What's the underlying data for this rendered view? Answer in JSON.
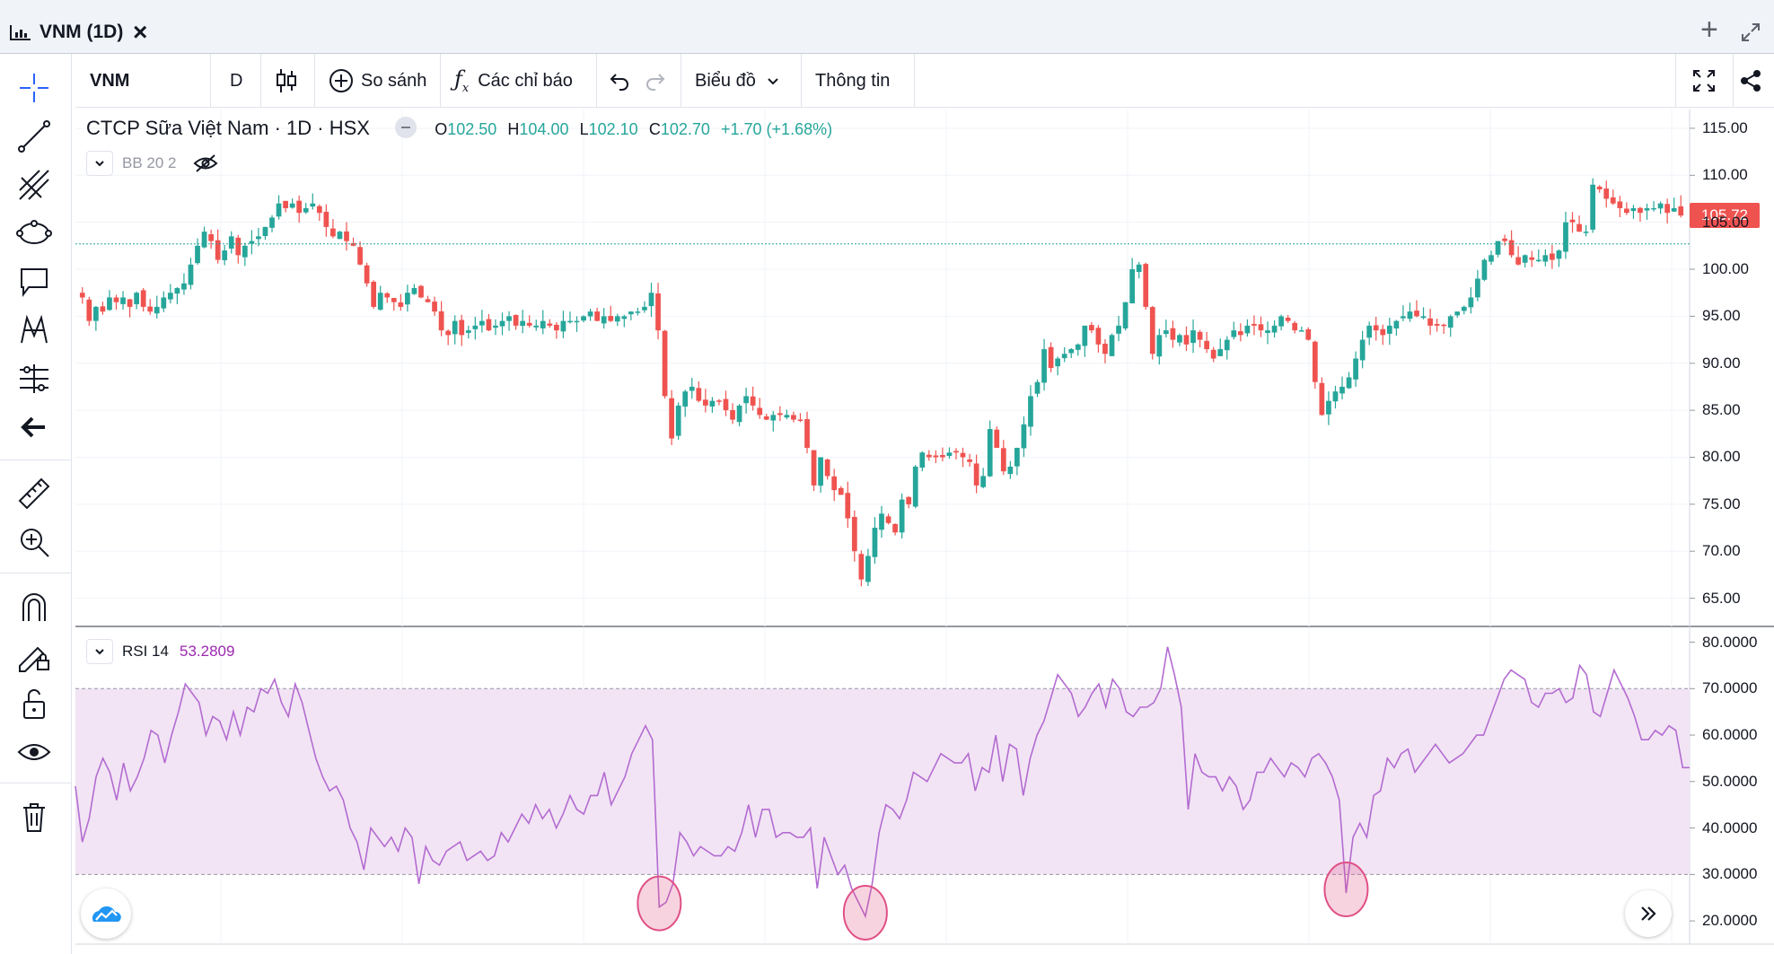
{
  "window": {
    "title": "VNM (1D)",
    "close_glyph": "×",
    "add_glyph": "+",
    "expand_icon": "expand-diagonal-icon"
  },
  "toolbar": {
    "symbol": "VNM",
    "interval": "D",
    "chart_style_icon": "candles-icon",
    "compare_label": "So sánh",
    "indicators_label": "Các chỉ báo",
    "chart_label": "Biểu đồ",
    "info_label": "Thông tin",
    "fullscreen_icon": "fullscreen-icon",
    "share_icon": "share-icon"
  },
  "left_toolbar": {
    "tools": [
      "crosshair-icon",
      "trend-line-icon",
      "fib-icon",
      "ellipse-icon",
      "callout-icon",
      "pattern-icon",
      "measure-line-icon",
      "back-arrow-icon",
      "ruler-icon",
      "zoom-in-icon",
      "magnet-icon",
      "lock-draw-icon",
      "lock-icon",
      "eye-icon",
      "trash-icon"
    ]
  },
  "legend": {
    "company": "CTCP Sữa Việt Nam",
    "interval": "1D",
    "exchange": "HSX",
    "dot": "·",
    "open_label": "O",
    "open": "102.50",
    "high_label": "H",
    "high": "104.00",
    "low_label": "L",
    "low": "102.10",
    "close_label": "C",
    "close": "102.70",
    "change": "+1.70 (+1.68%)"
  },
  "bb_legend": {
    "label": "BB 20 2"
  },
  "rsi_legend": {
    "label": "RSI 14",
    "value": "53.2809"
  },
  "price_badge": "105.72",
  "colors": {
    "up": "#26a69a",
    "down": "#ef5350",
    "rsi_line": "#b36bd1",
    "rsi_band": "#f2e4f4",
    "highlight_circle": "#e05085",
    "price_line": "#26a69a"
  },
  "chart_data": [
    {
      "type": "candlestick",
      "symbol": "VNM",
      "title": "CTCP Sữa Việt Nam",
      "ylim": [
        62,
        117
      ],
      "y_ticks": [
        "115.00",
        "110.00",
        "105.00",
        "100.00",
        "95.00",
        "90.00",
        "85.00",
        "80.00",
        "75.00",
        "70.00",
        "65.00"
      ],
      "last_price": 105.72,
      "closes": [
        97.0,
        94.5,
        96.0,
        95.5,
        97.0,
        96.5,
        97.0,
        96.0,
        97.5,
        96.0,
        95.5,
        96.0,
        97.0,
        97.5,
        98.0,
        98.5,
        100.5,
        102.5,
        104.0,
        103.0,
        101.0,
        102.0,
        103.5,
        101.5,
        102.5,
        103.0,
        103.5,
        104.5,
        105.5,
        107.0,
        106.5,
        107.0,
        106.0,
        106.5,
        107.0,
        106.0,
        104.5,
        103.5,
        104.0,
        103.0,
        102.5,
        100.5,
        98.5,
        96.0,
        97.5,
        97.0,
        96.5,
        96.0,
        97.5,
        98.0,
        97.0,
        96.5,
        95.5,
        93.5,
        93.0,
        94.5,
        93.0,
        93.5,
        94.0,
        94.5,
        93.5,
        94.0,
        94.5,
        95.0,
        94.0,
        94.5,
        94.0,
        94.0,
        94.5,
        94.0,
        93.5,
        94.5,
        94.5,
        94.5,
        95.0,
        95.5,
        94.5,
        95.0,
        94.5,
        95.0,
        95.0,
        95.5,
        95.5,
        96.0,
        97.5,
        93.5,
        86.5,
        82.0,
        85.5,
        87.0,
        87.5,
        86.0,
        85.5,
        86.0,
        86.0,
        85.0,
        84.0,
        85.5,
        86.5,
        85.5,
        84.5,
        84.0,
        84.5,
        84.5,
        84.5,
        84.0,
        84.0,
        81.0,
        77.0,
        80.0,
        78.0,
        76.5,
        76.0,
        73.5,
        70.0,
        67.0,
        69.5,
        72.5,
        74.0,
        73.0,
        72.0,
        75.5,
        75.0,
        79.0,
        80.5,
        80.0,
        80.0,
        80.0,
        80.5,
        80.5,
        80.0,
        79.5,
        77.0,
        78.0,
        83.0,
        81.0,
        78.5,
        79.0,
        81.0,
        83.5,
        86.5,
        88.0,
        91.5,
        89.5,
        90.5,
        91.0,
        91.5,
        92.0,
        94.0,
        93.5,
        92.0,
        91.0,
        93.0,
        94.0,
        96.5,
        100.0,
        100.5,
        96.0,
        91.0,
        93.0,
        93.5,
        92.5,
        93.0,
        92.0,
        93.5,
        92.5,
        91.5,
        90.5,
        91.5,
        92.5,
        93.5,
        93.0,
        94.0,
        94.0,
        93.5,
        93.5,
        94.0,
        95.0,
        94.5,
        93.5,
        93.5,
        92.5,
        88.0,
        84.5,
        86.0,
        87.0,
        87.5,
        88.5,
        90.5,
        92.5,
        94.0,
        93.5,
        93.0,
        94.0,
        94.5,
        95.0,
        95.5,
        95.0,
        95.0,
        94.0,
        94.0,
        94.0,
        95.0,
        95.5,
        96.0,
        97.0,
        99.0,
        101.0,
        101.5,
        103.0,
        103.0,
        101.5,
        100.5,
        101.5,
        101.0,
        101.0,
        101.5,
        101.0,
        102.0,
        105.0,
        105.0,
        104.0,
        104.0,
        109.0,
        108.5,
        107.5,
        107.0,
        106.5,
        106.0,
        106.5,
        106.0,
        106.5,
        106.5,
        107.0,
        106.0,
        106.5,
        105.72
      ]
    },
    {
      "type": "line",
      "name": "RSI 14",
      "ylim": [
        15,
        83
      ],
      "y_ticks": [
        "80.0000",
        "70.0000",
        "60.0000",
        "50.0000",
        "40.0000",
        "30.0000",
        "20.0000"
      ],
      "bands": [
        30,
        70
      ],
      "values": [
        49,
        37,
        42,
        51,
        55,
        52,
        46,
        54,
        48,
        51,
        55,
        61,
        60,
        54,
        60,
        65,
        71,
        69,
        67,
        60,
        64,
        63,
        59,
        65,
        60,
        66,
        65,
        70,
        69,
        72,
        67,
        64,
        71,
        67,
        61,
        55,
        51,
        48,
        49,
        46,
        40,
        37,
        31,
        40,
        38,
        36,
        38,
        35,
        40,
        38,
        28,
        36,
        33,
        32,
        35,
        36,
        37,
        33,
        34,
        35,
        33,
        34,
        39,
        37,
        40,
        43,
        41,
        45,
        42,
        44,
        40,
        43,
        47,
        44,
        43,
        47,
        47,
        52,
        45,
        48,
        51,
        56,
        59,
        62,
        59,
        23,
        24,
        28,
        39,
        37,
        34,
        36,
        35,
        34,
        34,
        36,
        35,
        39,
        45,
        38,
        44,
        44,
        38,
        39,
        39,
        38,
        38,
        40,
        27,
        38,
        34,
        30,
        32,
        27,
        24,
        21,
        28,
        39,
        45,
        44,
        42,
        46,
        52,
        51,
        50,
        53,
        56,
        55,
        54,
        54,
        56,
        48,
        53,
        52,
        60,
        50,
        58,
        57,
        47,
        55,
        60,
        63,
        68,
        73,
        71,
        69,
        64,
        66,
        69,
        71,
        66,
        72,
        70,
        65,
        64,
        66,
        66,
        67,
        70,
        79,
        73,
        66,
        44,
        56,
        52,
        51,
        51,
        48,
        51,
        49,
        44,
        46,
        52,
        52,
        55,
        53,
        51,
        54,
        53,
        51,
        55,
        56,
        54,
        51,
        46,
        26,
        38,
        41,
        38,
        47,
        48,
        55,
        53,
        56,
        57,
        52,
        54,
        56,
        58,
        56,
        54,
        55,
        56,
        58,
        60,
        60,
        64,
        68,
        72,
        74,
        73,
        72,
        67,
        66,
        69,
        69,
        70,
        67,
        68,
        75,
        73,
        65,
        64,
        69,
        74,
        71,
        68,
        64,
        59,
        59,
        61,
        60,
        62,
        61,
        53,
        53
      ]
    }
  ],
  "annotations": {
    "circles_count": 3
  }
}
